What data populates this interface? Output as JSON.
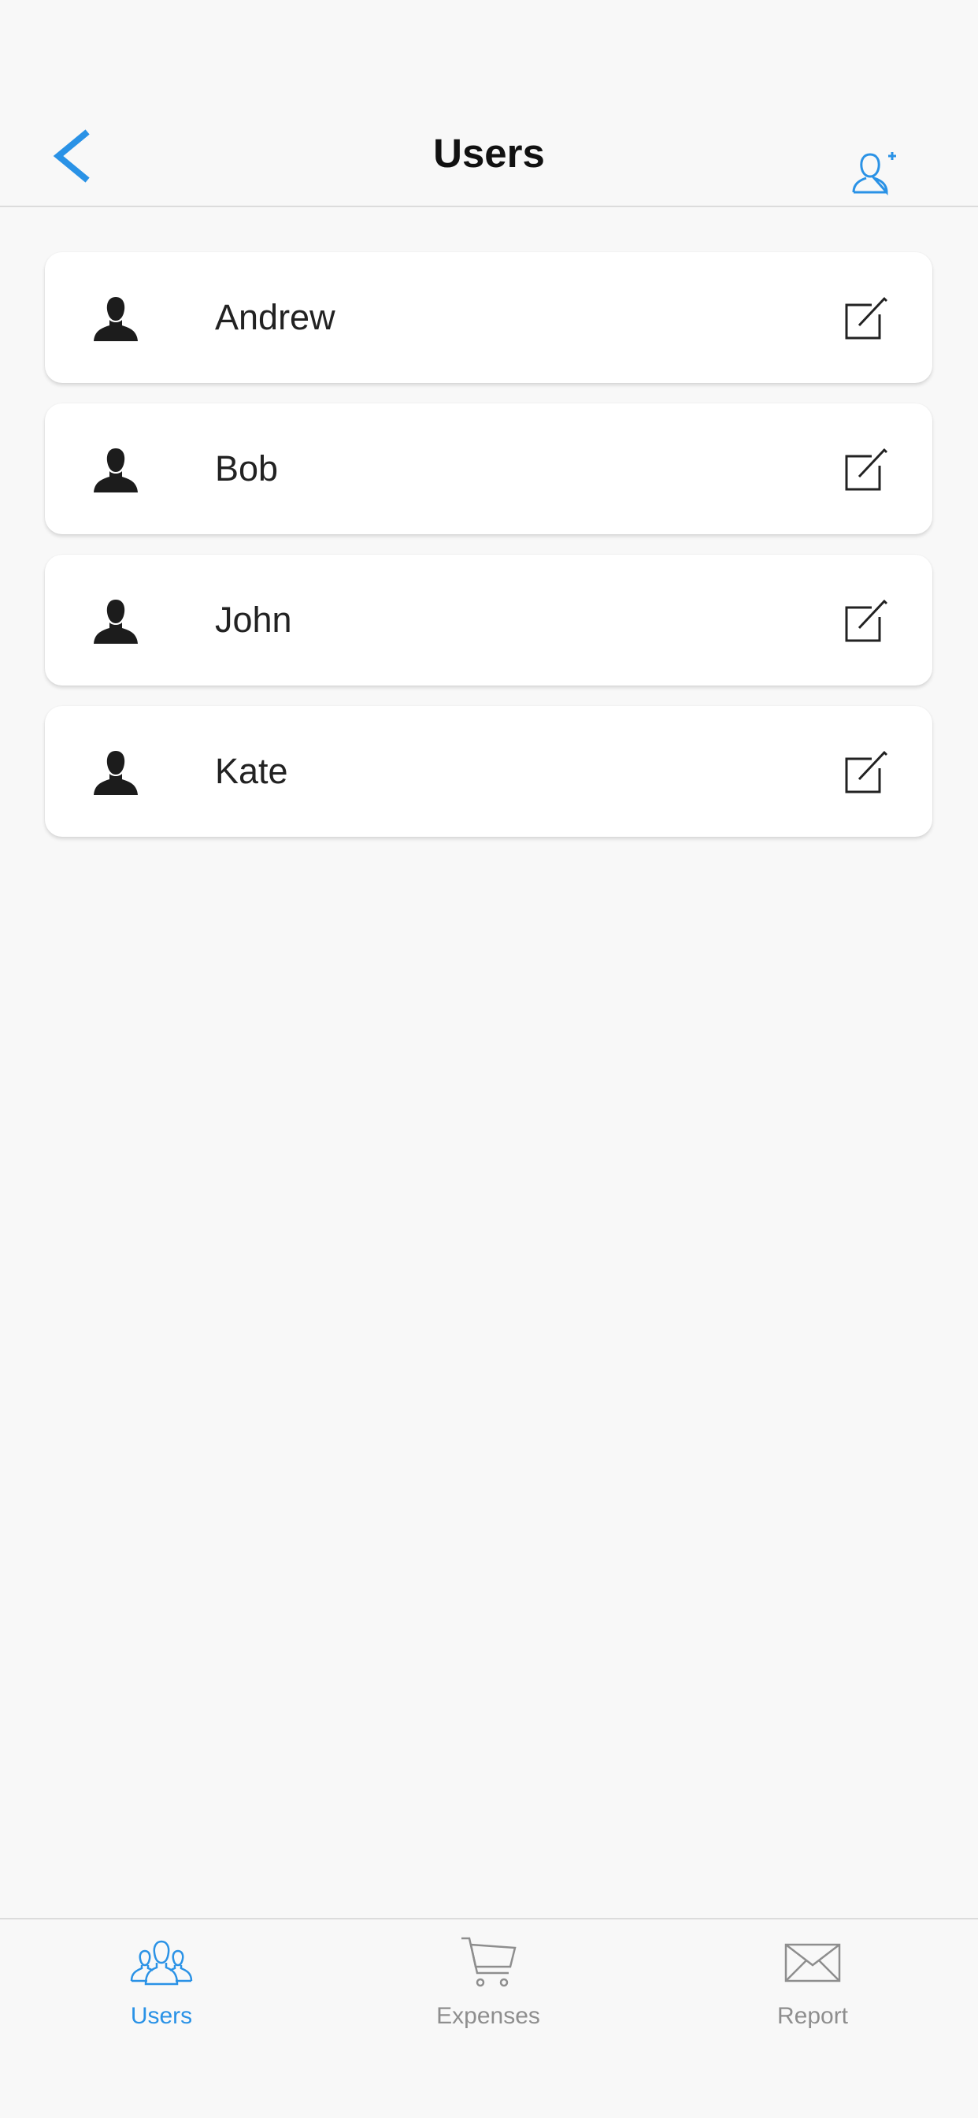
{
  "navbar": {
    "title": "Users",
    "back_icon": "chevron-left-icon",
    "add_user_icon": "add-user-icon"
  },
  "users": [
    {
      "name": "Andrew"
    },
    {
      "name": "Bob"
    },
    {
      "name": "John"
    },
    {
      "name": "Kate"
    }
  ],
  "tabs": [
    {
      "label": "Users",
      "icon": "users-icon",
      "active": true
    },
    {
      "label": "Expenses",
      "icon": "cart-icon",
      "active": false
    },
    {
      "label": "Report",
      "icon": "envelope-icon",
      "active": false
    }
  ],
  "colors": {
    "accent": "#2a92e6",
    "inactive": "#8e8e8e",
    "text": "#222222",
    "background": "#f8f8f8"
  }
}
